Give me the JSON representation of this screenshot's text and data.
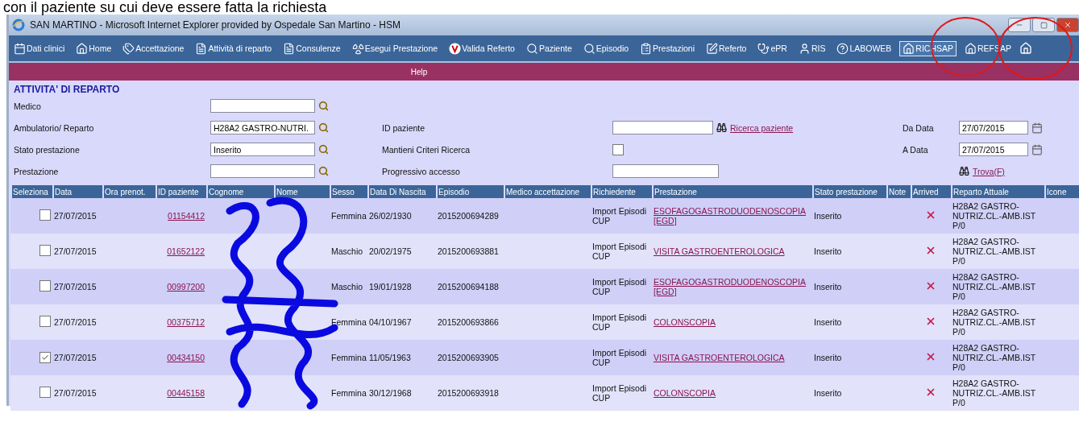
{
  "caption": "con il paziente su cui deve essere fatta la richiesta",
  "window": {
    "title": "SAN MARTINO - Microsoft Internet Explorer provided by Ospedale San Martino -  HSM"
  },
  "toolbar": [
    {
      "label": "Dati clinici",
      "selected": false
    },
    {
      "label": "Home",
      "selected": false
    },
    {
      "label": "Accettazione",
      "selected": false
    },
    {
      "label": "Attività di reparto",
      "selected": false
    },
    {
      "label": "Consulenze",
      "selected": false
    },
    {
      "label": "Esegui Prestazione",
      "selected": false
    },
    {
      "label": "Valida Referto",
      "selected": false
    },
    {
      "label": "Paziente",
      "selected": false
    },
    {
      "label": "Episodio",
      "selected": false
    },
    {
      "label": "Prestazioni",
      "selected": false
    },
    {
      "label": "Referto",
      "selected": false
    },
    {
      "label": "ePR",
      "selected": false
    },
    {
      "label": "RIS",
      "selected": false
    },
    {
      "label": "LABOWEB",
      "selected": false
    },
    {
      "label": "RICHSAP",
      "selected": true
    },
    {
      "label": "REFSAP",
      "selected": false
    }
  ],
  "menu_bar": {
    "label": "Help"
  },
  "form": {
    "title": "ATTIVITA' DI REPARTO",
    "rows": [
      [
        {
          "kind": "lookup",
          "label": "Medico"
        }
      ],
      [
        {
          "kind": "lookup",
          "label": "Ambulatorio/ Reparto",
          "value": "H28A2 GASTRO-NUTRI."
        },
        {
          "kind": "search",
          "label": "ID paziente",
          "link": "Ricerca paziente"
        },
        {
          "kind": "date",
          "label": "Da Data",
          "value": "27/07/2015"
        }
      ],
      [
        {
          "kind": "lookup",
          "label": "Stato prestazione",
          "value": "Inserito"
        },
        {
          "kind": "check",
          "label": "Mantieni Criteri Ricerca",
          "checked": false
        },
        {
          "kind": "date",
          "label": "A Data",
          "value": "27/07/2015"
        }
      ],
      [
        {
          "kind": "lookup",
          "label": "Prestazione"
        },
        {
          "kind": "text",
          "label": "Progressivo accesso"
        },
        {
          "kind": "find",
          "link": "Trova(F)"
        }
      ]
    ]
  },
  "table": {
    "columns": [
      "Seleziona",
      "Data",
      "Ora prenot.",
      "ID paziente",
      "Cognome",
      "Nome",
      "Sesso",
      "Data Di Nascita",
      "Episodio",
      "Medico accettazione",
      "Richiedente",
      "Prestazione",
      "Stato prestazione",
      "Note",
      "Arrived",
      "Reparto Attuale",
      "Icone"
    ],
    "rows": [
      {
        "selected": false,
        "data": "27/07/2015",
        "id_paziente": "01154412",
        "sesso": "Femmina",
        "data_nascita": "26/02/1930",
        "episodio": "2015200694289",
        "richiedente": "Import Episodi CUP",
        "prestazione": "ESOFAGOGASTRODUODENOSCOPIA [EGD]",
        "stato": "Inserito",
        "arrived": false,
        "reparto": "H28A2 GASTRO-NUTRIZ.CL.-AMB.IST P/0"
      },
      {
        "selected": false,
        "data": "27/07/2015",
        "id_paziente": "01652122",
        "sesso": "Maschio",
        "data_nascita": "20/02/1975",
        "episodio": "2015200693881",
        "richiedente": "Import Episodi CUP",
        "prestazione": "VISITA GASTROENTEROLOGICA",
        "stato": "Inserito",
        "arrived": false,
        "reparto": "H28A2 GASTRO-NUTRIZ.CL.-AMB.IST P/0"
      },
      {
        "selected": false,
        "data": "27/07/2015",
        "id_paziente": "00997200",
        "sesso": "Maschio",
        "data_nascita": "19/01/1928",
        "episodio": "2015200694188",
        "richiedente": "Import Episodi CUP",
        "prestazione": "ESOFAGOGASTRODUODENOSCOPIA [EGD]",
        "stato": "Inserito",
        "arrived": false,
        "reparto": "H28A2 GASTRO-NUTRIZ.CL.-AMB.IST P/0"
      },
      {
        "selected": false,
        "data": "27/07/2015",
        "id_paziente": "00375712",
        "sesso": "Femmina",
        "data_nascita": "04/10/1967",
        "episodio": "2015200693866",
        "richiedente": "Import Episodi CUP",
        "prestazione": "COLONSCOPIA",
        "stato": "Inserito",
        "arrived": false,
        "reparto": "H28A2 GASTRO-NUTRIZ.CL.-AMB.IST P/0"
      },
      {
        "selected": true,
        "data": "27/07/2015",
        "id_paziente": "00434150",
        "sesso": "Femmina",
        "data_nascita": "11/05/1963",
        "episodio": "2015200693905",
        "richiedente": "Import Episodi CUP",
        "prestazione": "VISITA GASTROENTEROLOGICA",
        "stato": "Inserito",
        "arrived": false,
        "reparto": "H28A2 GASTRO-NUTRIZ.CL.-AMB.IST P/0"
      },
      {
        "selected": false,
        "data": "27/07/2015",
        "id_paziente": "00445158",
        "sesso": "Femmina",
        "data_nascita": "30/12/1968",
        "episodio": "2015200693918",
        "richiedente": "Import Episodi CUP",
        "prestazione": "COLONSCOPIA",
        "stato": "Inserito",
        "arrived": false,
        "reparto": "H28A2 GASTRO-NUTRIZ.CL.-AMB.IST P/0"
      }
    ]
  }
}
